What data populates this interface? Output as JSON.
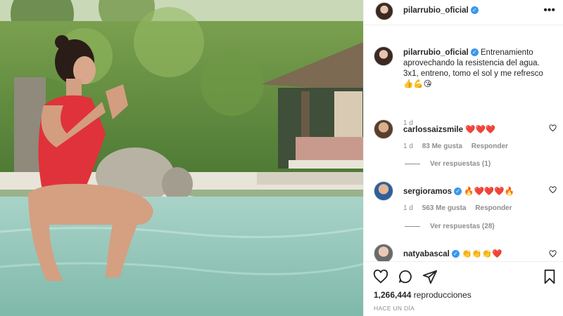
{
  "post": {
    "username": "pilarrubio_oficial",
    "caption_text": "Entrenamiento aprovechando la resistencia del agua. 3x1, entreno, tomo el sol y me refresco 👍💪😘",
    "caption_age": "1 d"
  },
  "comments": [
    {
      "username": "carlossaizsmile",
      "verified": false,
      "text": "❤️❤️❤️",
      "age": "1 d",
      "likes": "83 Me gusta",
      "reply_label": "Responder",
      "view_replies": "Ver respuestas (1)"
    },
    {
      "username": "sergioramos",
      "verified": true,
      "text": "🔥❤️❤️❤️🔥",
      "age": "1 d",
      "likes": "563 Me gusta",
      "reply_label": "Responder",
      "view_replies": "Ver respuestas (28)"
    },
    {
      "username": "natyabascal",
      "verified": true,
      "text": "👏👏👏❤️"
    }
  ],
  "footer": {
    "views_count": "1,266,444",
    "views_label": "reproducciones",
    "timestamp": "HACE UN DÍA"
  },
  "icons": {
    "more": "more-icon",
    "like": "heart-icon",
    "comment": "comment-icon",
    "share": "share-icon",
    "save": "bookmark-icon",
    "verified": "verified-badge-icon"
  },
  "colors": {
    "verified": "#3897f0",
    "muted": "#8e8e8e",
    "text": "#262626",
    "swimsuit": "#e0323a"
  }
}
